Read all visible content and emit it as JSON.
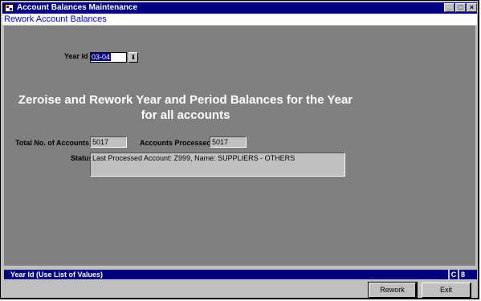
{
  "window": {
    "title": "Account Balances Maintenance",
    "minimize_glyph": "_",
    "restore_glyph": "□",
    "close_glyph": "×"
  },
  "form": {
    "header": "Rework Account Balances",
    "year_label": "Year Id",
    "year_value": "03-04",
    "lov_glyph": "⬇",
    "headline_line1": "Zeroise and Rework Year and Period Balances for the Year",
    "headline_line2": "for all accounts",
    "total_label": "Total No. of Accounts",
    "total_value": "5017",
    "processed_label": "Accounts Processed",
    "processed_value": "5017",
    "status_label": "Status",
    "status_value": "Last Processed Account: Z999, Name: SUPPLIERS - OTHERS"
  },
  "statusbar": {
    "hint": "Year Id (Use List of Values)",
    "mode": "C",
    "count": "8"
  },
  "buttons": {
    "rework": "Rework",
    "exit": "Exit"
  }
}
